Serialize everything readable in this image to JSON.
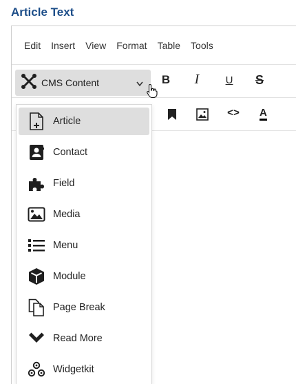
{
  "field_label": "Article Text",
  "menubar": {
    "items": [
      "Edit",
      "Insert",
      "View",
      "Format",
      "Table",
      "Tools"
    ]
  },
  "toolbar": {
    "cms_content_label": "CMS Content",
    "bold_label": "B",
    "italic_label": "I",
    "underline_label": "U",
    "strikethrough_label": "S",
    "code_label": "<>",
    "font_color_label": "A"
  },
  "dropdown": {
    "items": [
      {
        "label": "Article",
        "icon": "document-plus-icon",
        "active": true
      },
      {
        "label": "Contact",
        "icon": "contact-card-icon",
        "active": false
      },
      {
        "label": "Field",
        "icon": "puzzle-icon",
        "active": false
      },
      {
        "label": "Media",
        "icon": "image-icon",
        "active": false
      },
      {
        "label": "Menu",
        "icon": "list-icon",
        "active": false
      },
      {
        "label": "Module",
        "icon": "cube-icon",
        "active": false
      },
      {
        "label": "Page Break",
        "icon": "copy-icon",
        "active": false
      },
      {
        "label": "Read More",
        "icon": "chevron-down-icon",
        "active": false
      },
      {
        "label": "Widgetkit",
        "icon": "widgetkit-icon",
        "active": false
      }
    ]
  },
  "colors": {
    "field_label": "#1d4e89",
    "active_bg": "#dedede",
    "border": "#cfcfcf"
  }
}
